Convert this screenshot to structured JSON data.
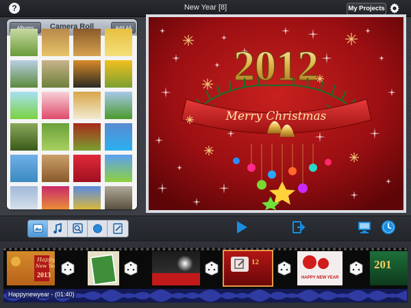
{
  "topbar": {
    "help_icon": "?",
    "title": "New Year  [8]",
    "my_projects_label": "My Projects",
    "settings_icon": "gear-icon"
  },
  "album": {
    "back_label": "Albums",
    "title": "Camera Roll",
    "add_all_label": "Add All",
    "thumb_count": 24
  },
  "preview": {
    "year_text": "2012",
    "banner_text": "Merry Christmas"
  },
  "toolbar": {
    "modes": [
      "photo-mode-icon",
      "music-mode-icon",
      "zoom-mode-icon",
      "transition-mode-icon",
      "edit-mode-icon"
    ],
    "active_mode_index": 0,
    "play_icon": "play-icon",
    "export_icon": "export-icon",
    "tv_icon": "tv-icon",
    "timer_icon": "clock-icon"
  },
  "timeline": {
    "clips": [
      {
        "name": "clip-happy-new-year-2013",
        "text_top": "Happy",
        "text_mid": "New Year",
        "text_year": "2013"
      },
      {
        "name": "clip-greeting-card"
      },
      {
        "name": "clip-fireworks"
      },
      {
        "name": "clip-selected-2012"
      },
      {
        "name": "clip-ornaments",
        "text": "HAPPY NEW YEAR"
      },
      {
        "name": "clip-201"
      }
    ],
    "audio_label": "Happynewyear - (01:40)"
  },
  "colors": {
    "accent_blue": "#1a8de0",
    "selected_clip": "#e59a4a"
  }
}
